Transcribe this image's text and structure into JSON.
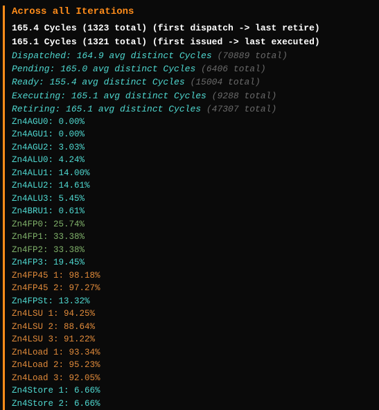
{
  "title": "Across all Iterations",
  "cycles": {
    "line1": "165.4 Cycles (1323 total) (first dispatch -> last retire)",
    "line2": "165.1 Cycles (1321 total) (first issued -> last executed)"
  },
  "stats": [
    {
      "label": "Dispatched: 164.9 avg distinct Cycles",
      "total": "(70889 total)"
    },
    {
      "label": "Pending: 165.0 avg distinct Cycles",
      "total": "(6406 total)"
    },
    {
      "label": "Ready: 155.4 avg distinct Cycles",
      "total": "(15004 total)"
    },
    {
      "label": "Executing: 165.1 avg distinct Cycles",
      "total": "(9288 total)"
    },
    {
      "label": "Retiring: 165.1 avg distinct Cycles",
      "total": "(47307 total)"
    }
  ],
  "units": [
    {
      "name": "Zn4AGU0",
      "pct": "0.00%",
      "color": "teal"
    },
    {
      "name": "Zn4AGU1",
      "pct": "0.00%",
      "color": "teal"
    },
    {
      "name": "Zn4AGU2",
      "pct": "3.03%",
      "color": "teal"
    },
    {
      "name": "Zn4ALU0",
      "pct": "4.24%",
      "color": "teal"
    },
    {
      "name": "Zn4ALU1",
      "pct": "14.00%",
      "color": "teal"
    },
    {
      "name": "Zn4ALU2",
      "pct": "14.61%",
      "color": "teal"
    },
    {
      "name": "Zn4ALU3",
      "pct": "5.45%",
      "color": "teal"
    },
    {
      "name": "Zn4BRU1",
      "pct": "0.61%",
      "color": "teal"
    },
    {
      "name": "Zn4FP0",
      "pct": "25.74%",
      "color": "green"
    },
    {
      "name": "Zn4FP1",
      "pct": "33.38%",
      "color": "green"
    },
    {
      "name": "Zn4FP2",
      "pct": "33.38%",
      "color": "green"
    },
    {
      "name": "Zn4FP3",
      "pct": "19.45%",
      "color": "teal"
    },
    {
      "name": "Zn4FP45 1",
      "pct": "98.18%",
      "color": "orange"
    },
    {
      "name": "Zn4FP45 2",
      "pct": "97.27%",
      "color": "orange"
    },
    {
      "name": "Zn4FPSt",
      "pct": "13.32%",
      "color": "teal"
    },
    {
      "name": "Zn4LSU 1",
      "pct": "94.25%",
      "color": "orange"
    },
    {
      "name": "Zn4LSU 2",
      "pct": "88.64%",
      "color": "orange"
    },
    {
      "name": "Zn4LSU 3",
      "pct": "91.22%",
      "color": "orange"
    },
    {
      "name": "Zn4Load 1",
      "pct": "93.34%",
      "color": "orange"
    },
    {
      "name": "Zn4Load 2",
      "pct": "95.23%",
      "color": "orange"
    },
    {
      "name": "Zn4Load 3",
      "pct": "92.05%",
      "color": "orange"
    },
    {
      "name": "Zn4Store 1",
      "pct": "6.66%",
      "color": "teal"
    },
    {
      "name": "Zn4Store 2",
      "pct": "6.66%",
      "color": "teal"
    }
  ]
}
